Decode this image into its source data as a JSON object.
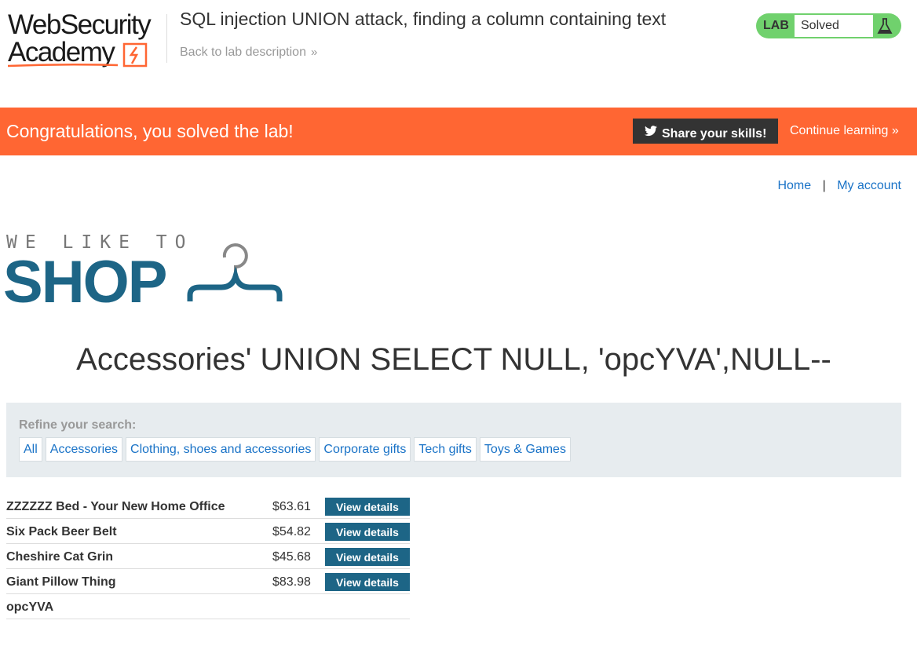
{
  "academy": {
    "logo_line1": "WebSecurity",
    "logo_line2": "Academy",
    "lab_title": "SQL injection UNION attack, finding a column containing text",
    "back_link": "Back to lab description",
    "status_tag": "LAB",
    "status_value": "Solved"
  },
  "banner": {
    "message": "Congratulations, you solved the lab!",
    "share_label": "Share your skills!",
    "continue_label": "Continue learning"
  },
  "nav": {
    "home": "Home",
    "separator": "|",
    "account": "My account"
  },
  "shop_logo": {
    "tagline": "WE LIKE TO",
    "word": "SHOP"
  },
  "category_heading": "Accessories' UNION SELECT NULL, 'opcYVA',NULL--",
  "filters": {
    "label": "Refine your search:",
    "items": [
      "All",
      "Accessories",
      "Clothing, shoes and accessories",
      "Corporate gifts",
      "Tech gifts",
      "Toys & Games"
    ]
  },
  "products": [
    {
      "name": "ZZZZZZ Bed - Your New Home Office",
      "price": "$63.61",
      "button": "View details"
    },
    {
      "name": "Six Pack Beer Belt",
      "price": "$54.82",
      "button": "View details"
    },
    {
      "name": "Cheshire Cat Grin",
      "price": "$45.68",
      "button": "View details"
    },
    {
      "name": "Giant Pillow Thing",
      "price": "$83.98",
      "button": "View details"
    },
    {
      "name": "opcYVA",
      "price": "",
      "button": ""
    }
  ],
  "colors": {
    "banner": "#ff6633",
    "status_green": "#70d16d",
    "shop_blue": "#1d6586",
    "link_blue": "#1a73c7"
  },
  "icons": [
    "academy-bolt-icon",
    "chevron-right-icon",
    "flask-icon",
    "twitter-bird-icon",
    "hanger-icon"
  ]
}
